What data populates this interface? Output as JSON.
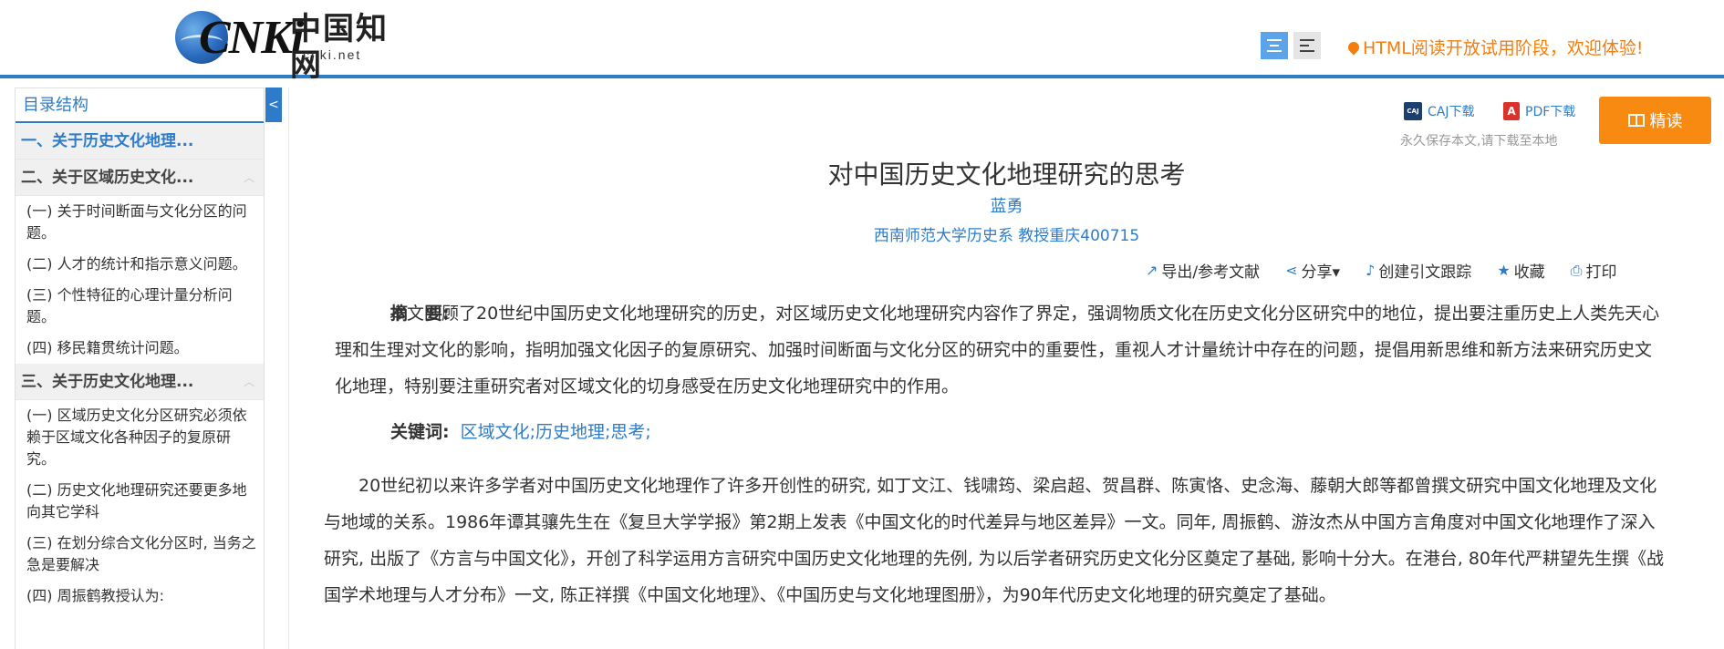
{
  "header": {
    "logo_brand": "CNKi",
    "logo_cn": "中国知网",
    "logo_domain": "cnki.net",
    "notice": "HTML阅读开放试用阶段，欢迎体验!"
  },
  "sidebar": {
    "title": "目录结构",
    "toggle_glyph": "<",
    "sections": [
      {
        "label": "一、关于历史文化地理...",
        "items": []
      },
      {
        "label": "二、关于区域历史文化...",
        "items": [
          "(一) 关于时间断面与文化分区的问题。",
          "(二) 人才的统计和指示意义问题。",
          "(三) 个性特征的心理计量分析问题。",
          "(四) 移民籍贯统计问题。"
        ]
      },
      {
        "label": "三、关于历史文化地理...",
        "items": [
          "(一) 区域历史文化分区研究必须依赖于区域文化各种因子的复原研究。",
          "(二) 历史文化地理研究还要更多地向其它学科",
          "(三) 在划分综合文化分区时, 当务之急是要解决",
          "(四) 周振鹤教授认为:"
        ]
      }
    ]
  },
  "downloads": {
    "caj_icon": "CAJ",
    "caj_label": "CAJ下载",
    "pdf_icon": "A",
    "pdf_label": "PDF下载",
    "save_note": "永久保存本文,请下载至本地",
    "read_label": "精读"
  },
  "article": {
    "title": "对中国历史文化地理研究的思考",
    "author": "蓝勇",
    "affiliation": "西南师范大学历史系 教授重庆400715",
    "tools": [
      {
        "icon": "export-icon",
        "glyph": "↗",
        "label": "导出/参考文献"
      },
      {
        "icon": "share-icon",
        "glyph": "⋖",
        "label": "分享▾"
      },
      {
        "icon": "bell-icon",
        "glyph": "♪",
        "label": "创建引文跟踪"
      },
      {
        "icon": "star-icon",
        "glyph": "★",
        "label": "收藏"
      },
      {
        "icon": "print-icon",
        "glyph": "⎙",
        "label": "打印"
      }
    ],
    "abstract_label": "摘　要:",
    "abstract": "本文回顾了20世纪中国历史文化地理研究的历史，对区域历史文化地理研究内容作了界定，强调物质文化在历史文化分区研究中的地位，提出要注重历史上人类先天心理和生理对文化的影响，指明加强文化因子的复原研究、加强时间断面与文化分区的研究中的重要性，重视人才计量统计中存在的问题，提倡用新思维和新方法来研究历史文化地理，特别要注重研究者对区域文化的切身感受在历史文化地理研究中的作用。",
    "keywords_label": "关键词:",
    "keywords": [
      "区域文化;",
      "历史地理;",
      "思考;"
    ],
    "body": "20世纪初以来许多学者对中国历史文化地理作了许多开创性的研究, 如丁文江、钱啸筠、梁启超、贺昌群、陈寅恪、史念海、藤朝大郎等都曾撰文研究中国文化地理及文化与地域的关系。1986年谭其骧先生在《复旦大学学报》第2期上发表《中国文化的时代差异与地区差异》一文。同年, 周振鹤、游汝杰从中国方言角度对中国文化地理作了深入研究, 出版了《方言与中国文化》，开创了科学运用方言研究中国历史文化地理的先例, 为以后学者研究历史文化分区奠定了基础, 影响十分大。在港台, 80年代严耕望先生撰《战国学术地理与人才分布》一文, 陈正祥撰《中国文化地理》、《中国历史与文化地理图册》，为90年代历史文化地理的研究奠定了基础。"
  }
}
